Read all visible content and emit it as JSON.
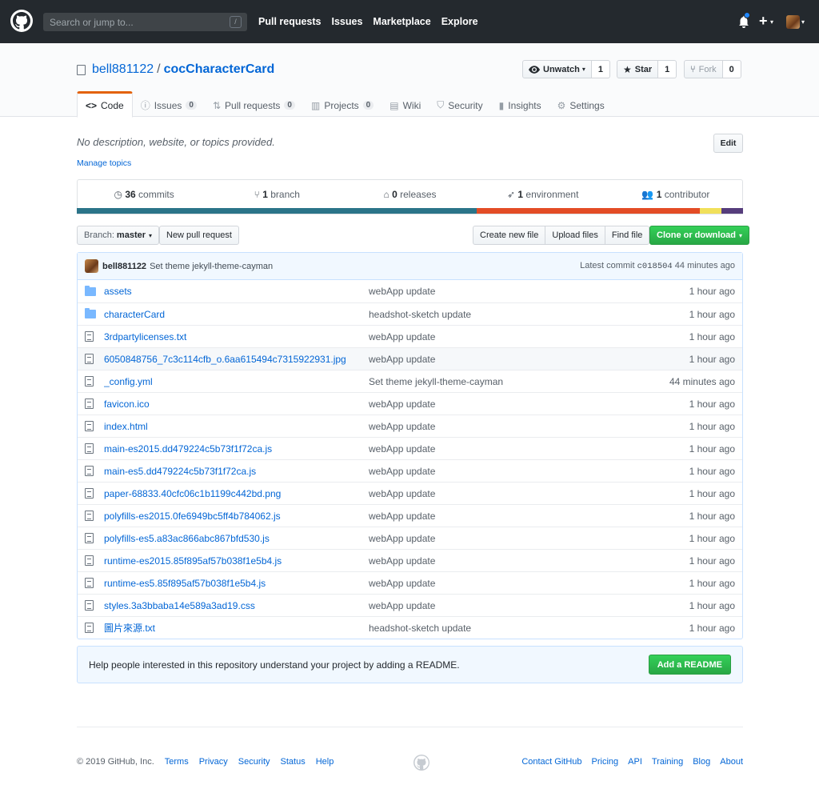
{
  "header": {
    "search_placeholder": "Search or jump to...",
    "search_shortcut": "/",
    "nav": [
      "Pull requests",
      "Issues",
      "Marketplace",
      "Explore"
    ],
    "plus": "+",
    "caret": "▾"
  },
  "repo": {
    "owner": "bell881122",
    "separator": "/",
    "name": "cocCharacterCard",
    "watch_label": "Unwatch",
    "watch_count": "1",
    "star_label": "Star",
    "star_count": "1",
    "fork_label": "Fork",
    "fork_count": "0"
  },
  "reponav": {
    "code": "Code",
    "issues": "Issues",
    "issues_count": "0",
    "pulls": "Pull requests",
    "pulls_count": "0",
    "projects": "Projects",
    "projects_count": "0",
    "wiki": "Wiki",
    "security": "Security",
    "insights": "Insights",
    "settings": "Settings"
  },
  "description": {
    "text": "No description, website, or topics provided.",
    "manage_topics": "Manage topics",
    "edit": "Edit"
  },
  "summary": {
    "commits_count": "36",
    "commits_label": "commits",
    "branch_count": "1",
    "branch_label": "branch",
    "releases_count": "0",
    "releases_label": "releases",
    "environment_count": "1",
    "environment_label": "environment",
    "contributor_count": "1",
    "contributor_label": "contributor",
    "languages": [
      {
        "color": "#2b7489",
        "share": 0.6
      },
      {
        "color": "#e34c26",
        "share": 0.335
      },
      {
        "color": "#f1e05a",
        "share": 0.033
      },
      {
        "color": "#563d7c",
        "share": 0.032
      }
    ]
  },
  "file_nav": {
    "branch_label": "Branch:",
    "branch_name": "master",
    "new_pr": "New pull request",
    "create_file": "Create new file",
    "upload_files": "Upload files",
    "find_file": "Find file",
    "clone": "Clone or download"
  },
  "latest_commit": {
    "author": "bell881122",
    "message": "Set theme jekyll-theme-cayman",
    "prefix": "Latest commit",
    "sha": "c018504",
    "age": "44 minutes ago"
  },
  "files": [
    {
      "type": "dir",
      "name": "assets",
      "message": "webApp update",
      "age": "1 hour ago"
    },
    {
      "type": "dir",
      "name": "characterCard",
      "message": "headshot-sketch update",
      "age": "1 hour ago"
    },
    {
      "type": "file",
      "name": "3rdpartylicenses.txt",
      "message": "webApp update",
      "age": "1 hour ago"
    },
    {
      "type": "file",
      "name": "6050848756_7c3c114cfb_o.6aa615494c7315922931.jpg",
      "message": "webApp update",
      "age": "1 hour ago"
    },
    {
      "type": "file",
      "name": "_config.yml",
      "message": "Set theme jekyll-theme-cayman",
      "age": "44 minutes ago"
    },
    {
      "type": "file",
      "name": "favicon.ico",
      "message": "webApp update",
      "age": "1 hour ago"
    },
    {
      "type": "file",
      "name": "index.html",
      "message": "webApp update",
      "age": "1 hour ago"
    },
    {
      "type": "file",
      "name": "main-es2015.dd479224c5b73f1f72ca.js",
      "message": "webApp update",
      "age": "1 hour ago"
    },
    {
      "type": "file",
      "name": "main-es5.dd479224c5b73f1f72ca.js",
      "message": "webApp update",
      "age": "1 hour ago"
    },
    {
      "type": "file",
      "name": "paper-68833.40cfc06c1b1199c442bd.png",
      "message": "webApp update",
      "age": "1 hour ago"
    },
    {
      "type": "file",
      "name": "polyfills-es2015.0fe6949bc5ff4b784062.js",
      "message": "webApp update",
      "age": "1 hour ago"
    },
    {
      "type": "file",
      "name": "polyfills-es5.a83ac866abc867bfd530.js",
      "message": "webApp update",
      "age": "1 hour ago"
    },
    {
      "type": "file",
      "name": "runtime-es2015.85f895af57b038f1e5b4.js",
      "message": "webApp update",
      "age": "1 hour ago"
    },
    {
      "type": "file",
      "name": "runtime-es5.85f895af57b038f1e5b4.js",
      "message": "webApp update",
      "age": "1 hour ago"
    },
    {
      "type": "file",
      "name": "styles.3a3bbaba14e589a3ad19.css",
      "message": "webApp update",
      "age": "1 hour ago"
    },
    {
      "type": "file",
      "name": "圖片來源.txt",
      "message": "headshot-sketch update",
      "age": "1 hour ago"
    }
  ],
  "readme_prompt": {
    "text": "Help people interested in this repository understand your project by adding a README.",
    "button": "Add a README"
  },
  "footer": {
    "copyright": "© 2019 GitHub, Inc.",
    "left_links": [
      "Terms",
      "Privacy",
      "Security",
      "Status",
      "Help"
    ],
    "right_links": [
      "Contact GitHub",
      "Pricing",
      "API",
      "Training",
      "Blog",
      "About"
    ]
  }
}
